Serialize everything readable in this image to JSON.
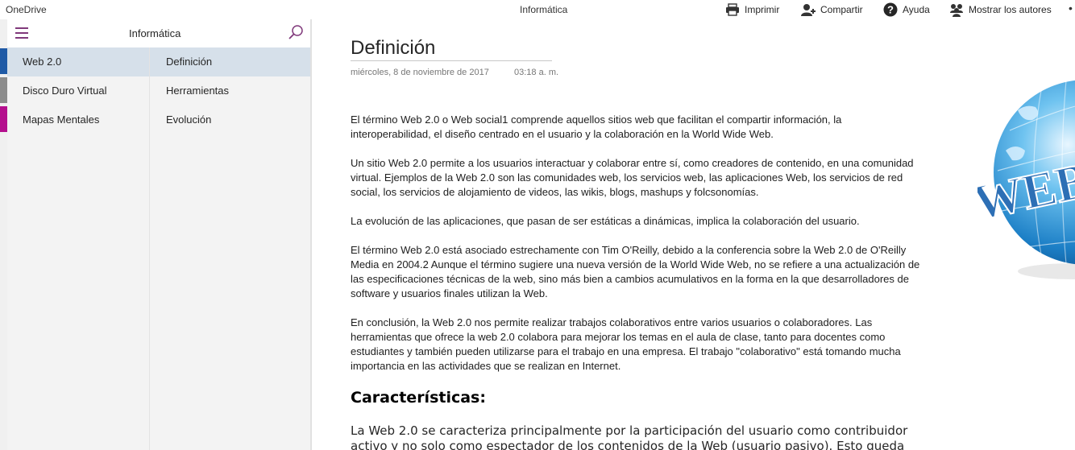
{
  "app": {
    "name": "OneDrive",
    "document_title": "Informática"
  },
  "toolbar": {
    "print_label": "Imprimir",
    "share_label": "Compartir",
    "help_label": "Ayuda",
    "authors_label": "Mostrar los autores",
    "more_label": "•"
  },
  "notebook": {
    "title": "Informática",
    "sections": [
      {
        "label": "Web 2.0",
        "color": "#1f5aa6",
        "active": true
      },
      {
        "label": "Disco Duro Virtual",
        "color": "#8c8c8c",
        "active": false
      },
      {
        "label": "Mapas Mentales",
        "color": "#b40f8d",
        "active": false
      }
    ],
    "pages": [
      {
        "label": "Definición",
        "active": true
      },
      {
        "label": "Herramientas",
        "active": false
      },
      {
        "label": "Evolución",
        "active": false
      }
    ]
  },
  "page": {
    "title": "Definición",
    "date": "miércoles, 8 de noviembre de 2017",
    "time": "03:18 a. m.",
    "paragraphs": [
      "El término Web 2.0 o Web social1 comprende aquellos sitios web que facilitan el compartir información, la interoperabilidad, el diseño centrado en el usuario y la colaboración en la World Wide Web.",
      "Un sitio Web 2.0 permite a los usuarios interactuar y colaborar entre sí, como creadores de contenido, en una comunidad virtual. Ejemplos de la Web 2.0 son las comunidades web, los servicios web, las aplicaciones Web, los servicios de red social, los servicios de alojamiento de videos, las wikis, blogs, mashups y folcsonomías.",
      "La evolución de las aplicaciones, que pasan de ser estáticas a dinámicas, implica la colaboración del usuario.",
      "El término Web 2.0 está asociado estrechamente con Tim O'Reilly, debido a la conferencia sobre la Web 2.0 de O'Reilly Media en 2004.2 Aunque el término sugiere una nueva versión de la World Wide Web, no se refiere a una actualización de las especificaciones técnicas de la web, sino más bien a cambios acumulativos en la forma en la que desarrolladores de software y usuarios finales utilizan la Web.",
      "En conclusión, la Web 2.0 nos permite realizar trabajos colaborativos entre varios usuarios o colaboradores. Las herramientas que ofrece la web 2.0 colabora para mejorar los temas en el aula de clase, tanto para docentes como estudiantes y también pueden utilizarse para el trabajo en una empresa. El trabajo \"colaborativo\" está tomando mucha importancia en las actividades que se realizan en Internet."
    ],
    "heading": "Características:",
    "last_paragraph": "La Web 2.0 se caracteriza principalmente por la participación del usuario como contribuidor activo y no solo como espectador de los contenidos de la Web (usuario pasivo). Esto queda",
    "image_text": "WEB"
  },
  "colors": {
    "accent": "#80397b",
    "selected_bg": "#d6e0ea"
  }
}
